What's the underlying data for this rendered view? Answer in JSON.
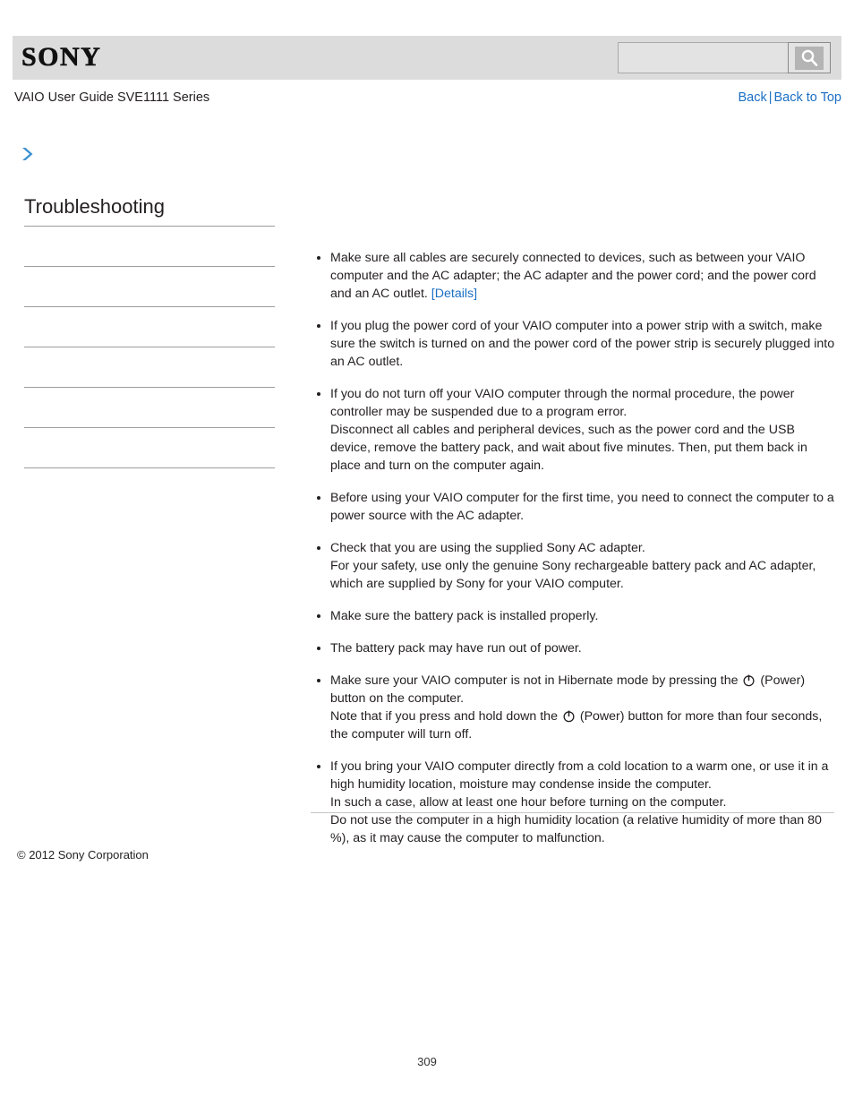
{
  "header": {
    "logo_text": "SONY",
    "search": {
      "value": "",
      "placeholder": "",
      "icon": "search-icon",
      "button_label": ""
    }
  },
  "subheader": {
    "guide_title": "VAIO User Guide SVE1111 Series",
    "back_label": "Back",
    "separator": "|",
    "back_to_top_label": "Back to Top"
  },
  "breadcrumb": {
    "icon": "chevron-right-icon",
    "label": ""
  },
  "sidebar": {
    "title": "Troubleshooting",
    "items": [
      {
        "label": ""
      },
      {
        "label": ""
      },
      {
        "label": ""
      },
      {
        "label": ""
      },
      {
        "label": ""
      },
      {
        "label": ""
      }
    ]
  },
  "content": {
    "bullets": [
      {
        "id": "cables-secure",
        "lines": [
          {
            "text": "Make sure all cables are securely connected to devices, such as between your VAIO computer and the AC adapter; the AC adapter and the power cord; and the power cord and an AC outlet. "
          },
          {
            "link": "[Details]"
          }
        ]
      },
      {
        "id": "power-strip",
        "lines": [
          {
            "text": "If you plug the power cord of your VAIO computer into a power strip with a switch, make sure the switch is turned on and the power cord of the power strip is securely plugged into an AC outlet."
          }
        ]
      },
      {
        "id": "power-controller-suspended",
        "lines": [
          {
            "text": "If you do not turn off your VAIO computer through the normal procedure, the power controller may be suspended due to a program error."
          },
          {
            "break": true
          },
          {
            "text": "Disconnect all cables and peripheral devices, such as the power cord and the USB device, remove the battery pack, and wait about five minutes. Then, put them back in place and turn on the computer again."
          }
        ]
      },
      {
        "id": "first-time-ac-adapter",
        "lines": [
          {
            "text": "Before using your VAIO computer for the first time, you need to connect the computer to a power source with the AC adapter."
          }
        ]
      },
      {
        "id": "supplied-sony-adapter",
        "lines": [
          {
            "text": "Check that you are using the supplied Sony AC adapter."
          },
          {
            "break": true
          },
          {
            "text": "For your safety, use only the genuine Sony rechargeable battery pack and AC adapter, which are supplied by Sony for your VAIO computer."
          }
        ]
      },
      {
        "id": "battery-installed",
        "lines": [
          {
            "text": "Make sure the battery pack is installed properly."
          }
        ]
      },
      {
        "id": "battery-out-of-power",
        "lines": [
          {
            "text": "The battery pack may have run out of power."
          }
        ]
      },
      {
        "id": "hibernate-mode",
        "lines": [
          {
            "text": "Make sure your VAIO computer is not in Hibernate mode by pressing the "
          },
          {
            "icon": "power-icon"
          },
          {
            "text": " (Power) button on the computer."
          },
          {
            "break": true
          },
          {
            "text": "Note that if you press and hold down the "
          },
          {
            "icon": "power-icon"
          },
          {
            "text": " (Power) button for more than four seconds, the computer will turn off."
          }
        ]
      },
      {
        "id": "condensation",
        "lines": [
          {
            "text": "If you bring your VAIO computer directly from a cold location to a warm one, or use it in a high humidity location, moisture may condense inside the computer."
          },
          {
            "break": true
          },
          {
            "text": "In such a case, allow at least one hour before turning on the computer."
          },
          {
            "break": true
          },
          {
            "text": "Do not use the computer in a high humidity location (a relative humidity of more than 80 %), as it may cause the computer to malfunction."
          }
        ]
      }
    ]
  },
  "footer": {
    "copyright": "© 2012 Sony Corporation",
    "page_number": "309"
  },
  "colors": {
    "link": "#1b6fc4",
    "header_bg": "#dcdcdc",
    "text": "#231f20",
    "rule": "#9c9c9c"
  }
}
